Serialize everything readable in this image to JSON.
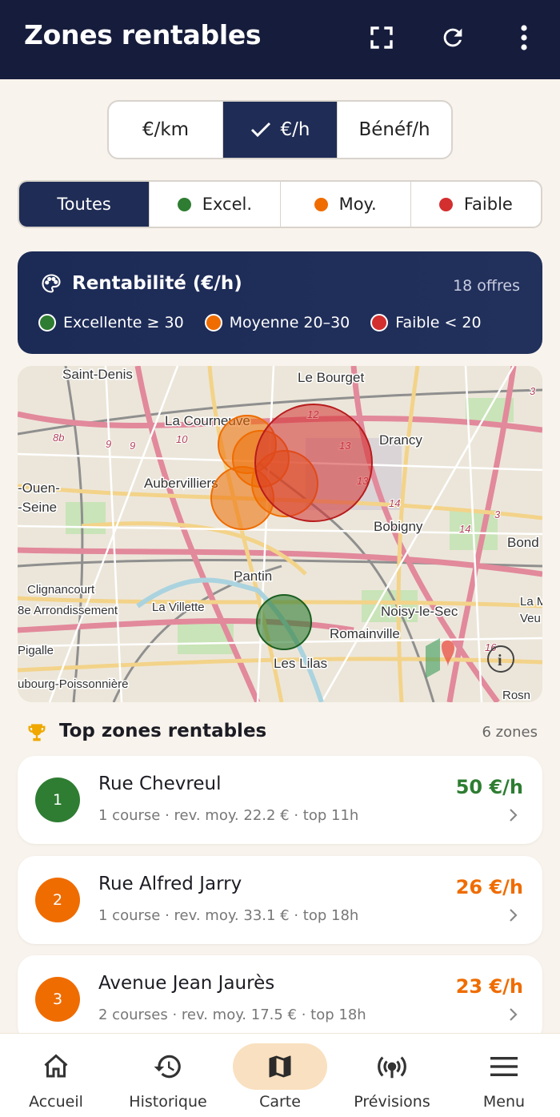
{
  "appbar": {
    "title": "Zones rentables",
    "icons": [
      "fullscreen-icon",
      "refresh-icon",
      "more-vert-icon"
    ]
  },
  "metric_toggle": {
    "options": [
      "€/km",
      "€/h",
      "Bénéf/h"
    ],
    "selected": "€/h"
  },
  "filters": {
    "options": [
      "Toutes",
      "Excel.",
      "Moy.",
      "Faible"
    ],
    "selected": "Toutes"
  },
  "legend": {
    "title": "Rentabilité (€/h)",
    "count": "18 offres",
    "items": [
      {
        "label": "Excellente ≥ 30",
        "color": "#2e7d32"
      },
      {
        "label": "Moyenne 20–30",
        "color": "#ef6c00"
      },
      {
        "label": "Faible < 20",
        "color": "#d32f2f"
      }
    ]
  },
  "map": {
    "place_labels": [
      "Saint-Denis",
      "Le Bourget",
      "La Courneuve",
      "Drancy",
      "Aubervilliers",
      "-Ouen-",
      "-Seine",
      "Bobigny",
      "Bond",
      "Pantin",
      "Clignancourt",
      "8e Arrondissement",
      "La Villette",
      "Noisy-le-Sec",
      "La Ma",
      "Veu",
      "Romainville",
      "Pigalle",
      "Les Lilas",
      "ubourg-Poissonnière",
      "Rosn"
    ],
    "road_labels": [
      "12",
      "13",
      "13",
      "14",
      "14",
      "8b",
      "9",
      "9",
      "10",
      "3",
      "3",
      "16"
    ]
  },
  "top": {
    "title": "Top zones rentables",
    "count": "6 zones",
    "zones": [
      {
        "rank": "1",
        "name": "Rue Chevreul",
        "details": "1 course · rev. moy. 22.2 € · top 11h",
        "rate": "50 €/h",
        "color": "#2e7d32"
      },
      {
        "rank": "2",
        "name": "Rue Alfred Jarry",
        "details": "1 course · rev. moy. 33.1 € · top 18h",
        "rate": "26 €/h",
        "color": "#ef6c00"
      },
      {
        "rank": "3",
        "name": "Avenue Jean Jaurès",
        "details": "2 courses · rev. moy. 17.5 € · top 18h",
        "rate": "23 €/h",
        "color": "#ef6c00"
      }
    ]
  },
  "nav": {
    "items": [
      "Accueil",
      "Historique",
      "Carte",
      "Prévisions",
      "Menu"
    ],
    "selected": "Carte"
  }
}
